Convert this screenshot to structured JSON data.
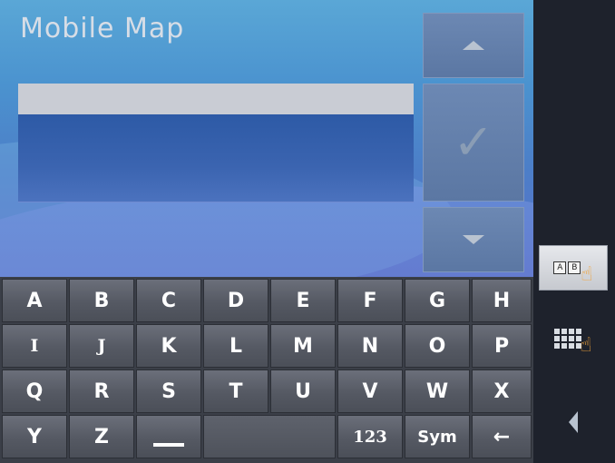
{
  "app": {
    "title": "Mobile Map"
  },
  "search": {
    "value": "",
    "placeholder": ""
  },
  "side_buttons": {
    "up_icon": "arrow-up-icon",
    "ok_icon": "checkmark-icon",
    "down_icon": "arrow-down-icon"
  },
  "keyboard": {
    "rows": [
      [
        "A",
        "B",
        "C",
        "D",
        "E",
        "F",
        "G",
        "H"
      ],
      [
        "I",
        "J",
        "K",
        "L",
        "M",
        "N",
        "O",
        "P"
      ],
      [
        "Q",
        "R",
        "S",
        "T",
        "U",
        "V",
        "W",
        "X"
      ]
    ],
    "row4": {
      "y": "Y",
      "z": "Z",
      "num": "123",
      "sym": "Sym",
      "backspace": "←"
    }
  },
  "right_panel": {
    "ab_label_a": "A",
    "ab_label_b": "B"
  },
  "colors": {
    "accent": "#4b93cf",
    "keycap": "#555963",
    "panel": "#1e222c"
  }
}
